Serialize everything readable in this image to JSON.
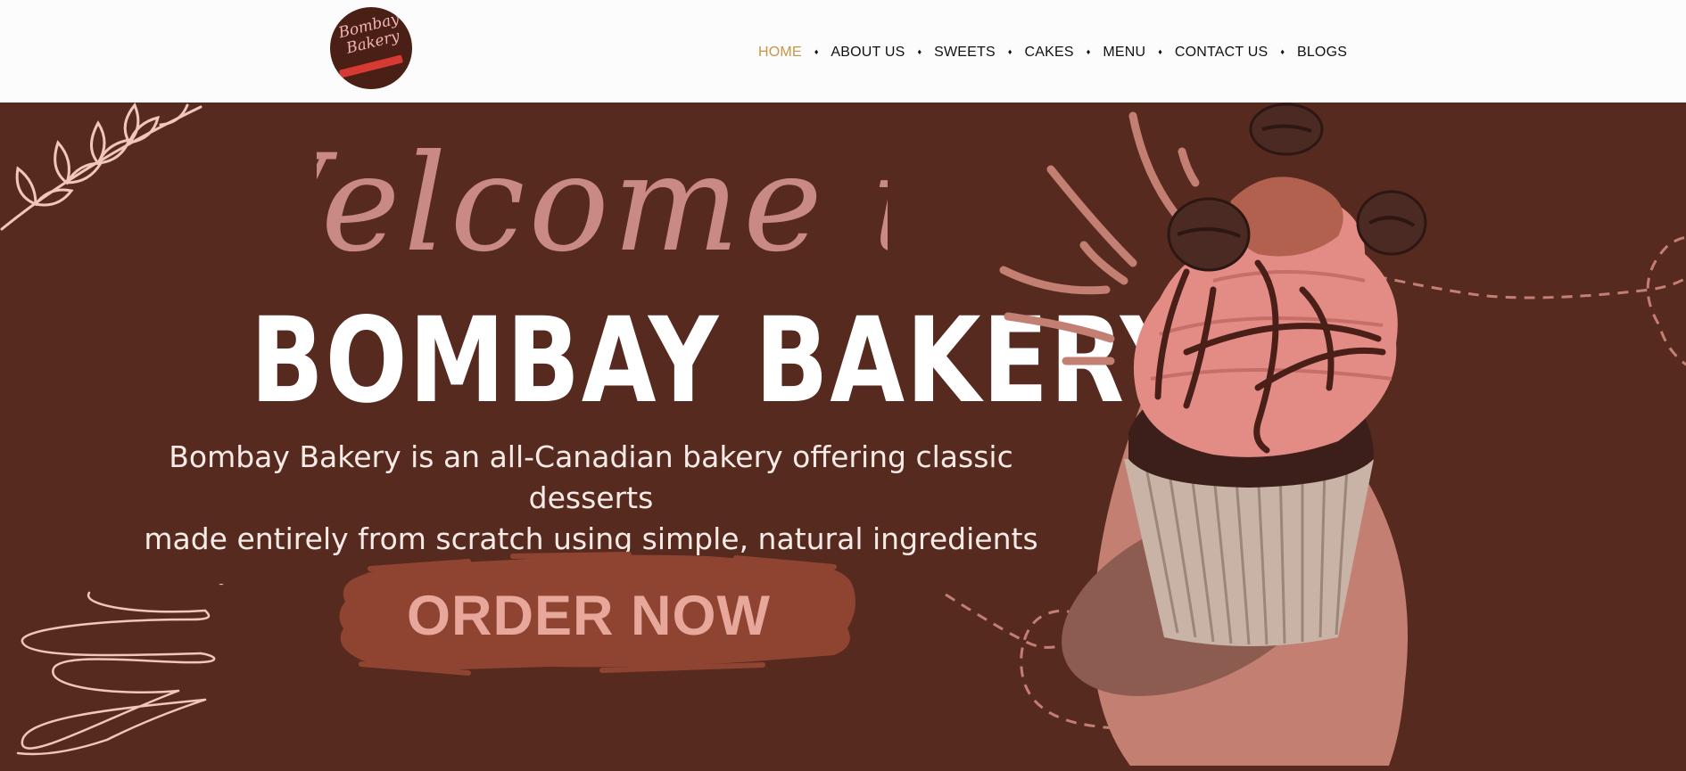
{
  "header": {
    "logo_text": "Bombay Bakery",
    "nav": [
      {
        "label": "HOME",
        "active": true
      },
      {
        "label": "ABOUT US"
      },
      {
        "label": "SWEETS"
      },
      {
        "label": "CAKES"
      },
      {
        "label": "MENU"
      },
      {
        "label": "CONTACT US"
      },
      {
        "label": "BLOGS"
      }
    ],
    "separator": "♦"
  },
  "hero": {
    "welcome": "Welcome to",
    "brand": "BOMBAY BAKERY",
    "tagline_line1": "Bombay Bakery is an all-Canadian bakery offering classic desserts",
    "tagline_line2": "made entirely from scratch using simple, natural ingredients",
    "cta": "ORDER NOW"
  },
  "colors": {
    "background": "#572a20",
    "header": "#fdfcfc",
    "nav_active": "#c79547",
    "welcome_text": "#c98a86",
    "brush": "#8f4432",
    "cta_text": "#e7a79a",
    "accent_pink": "#c27f72"
  },
  "icons": [
    "logo-badge",
    "leaf-branch-icon",
    "squiggle-icon",
    "cupcake-image"
  ]
}
